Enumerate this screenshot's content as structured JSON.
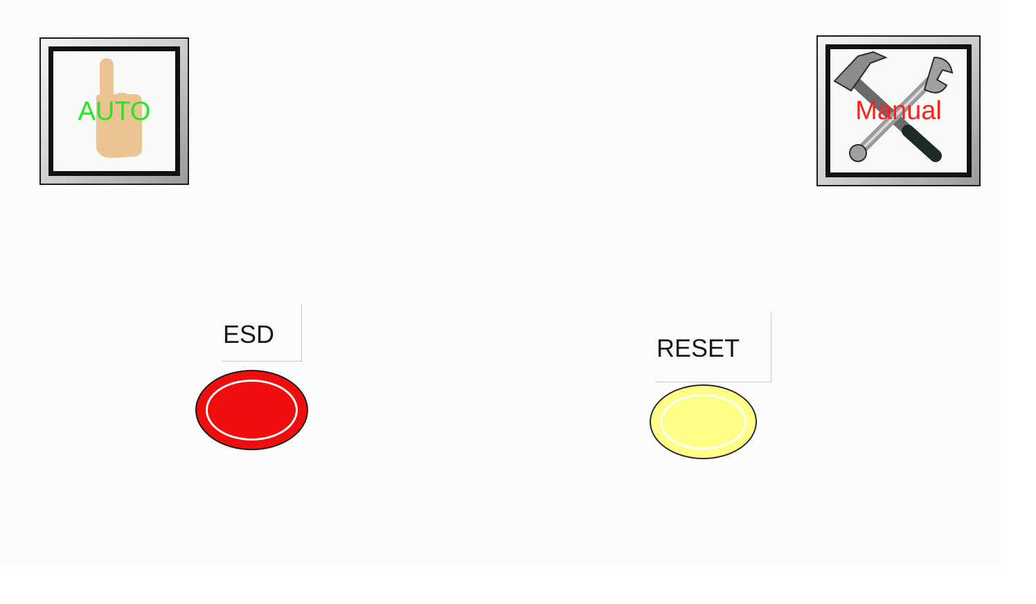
{
  "auto_button": {
    "label": "AUTO",
    "label_color": "#22e822",
    "icon": "pointing-hand-icon"
  },
  "manual_button": {
    "label": "Manual",
    "label_color": "#ff2020",
    "icon": "hammer-wrench-icon"
  },
  "esd": {
    "label": "ESD",
    "lamp_color": "#ef0d0d"
  },
  "reset": {
    "label": "RESET",
    "lamp_color": "#ffff88"
  }
}
